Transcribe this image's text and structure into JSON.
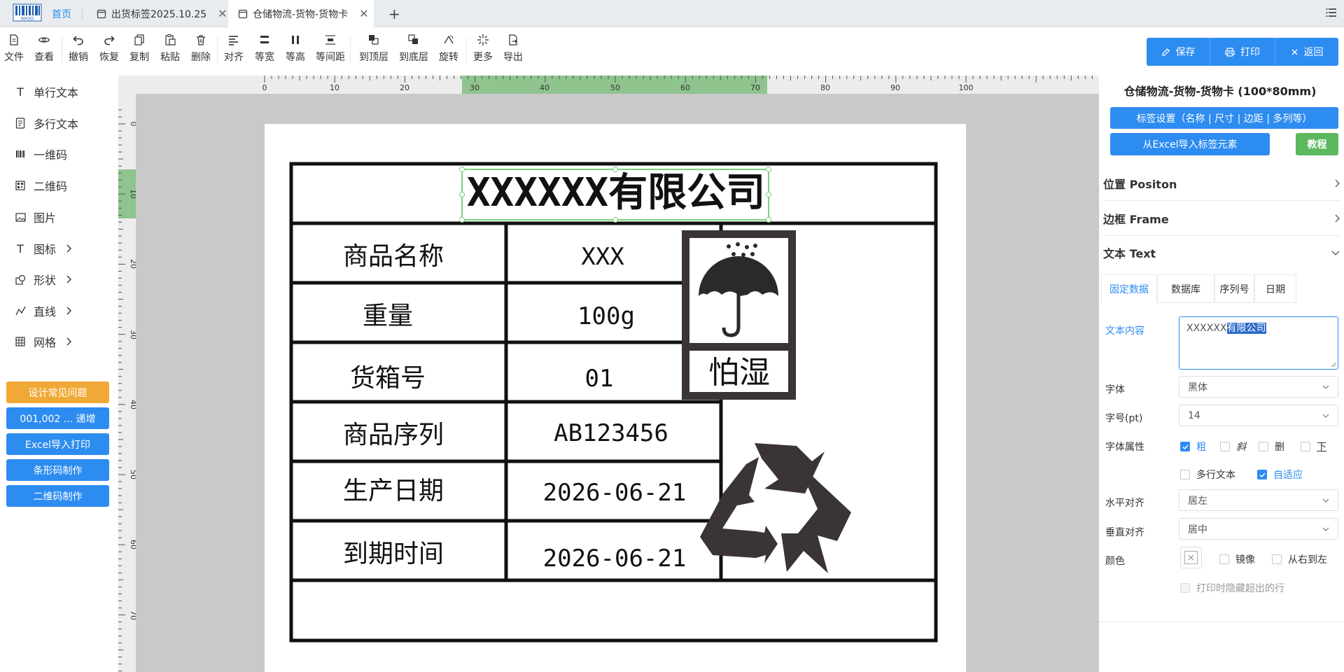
{
  "tabs": {
    "home": "首页",
    "tab1": "出货标签2025.10.25",
    "tab2": "仓储物流-货物-货物卡",
    "new_tab": "+",
    "logo_text": "MASO"
  },
  "toolbar": {
    "file": "文件",
    "view": "查看",
    "undo": "撤销",
    "redo": "恢复",
    "copy": "复制",
    "paste": "粘贴",
    "delete": "删除",
    "align": "对齐",
    "equal_width": "等宽",
    "equal_height": "等高",
    "equal_spacing": "等间距",
    "to_top": "到顶层",
    "to_bottom": "到底层",
    "rotate": "旋转",
    "more": "更多",
    "export": "导出",
    "save": "保存",
    "print": "打印",
    "back": "返回"
  },
  "left_panel": {
    "items": [
      "单行文本",
      "多行文本",
      "一维码",
      "二维码",
      "图片",
      "图标",
      "形状",
      "直线",
      "网格"
    ],
    "buttons": [
      "设计常见问题",
      "001,002 ... 递增",
      "Excel导入打印",
      "条形码制作",
      "二维码制作"
    ]
  },
  "rulers": {
    "top": [
      "0",
      "10",
      "20",
      "30",
      "40",
      "50",
      "60",
      "70",
      "80",
      "90",
      "100"
    ],
    "left": [
      "0",
      "10",
      "20",
      "30",
      "40",
      "50",
      "60",
      "70"
    ]
  },
  "label": {
    "company": "XXXXXX有限公司",
    "rows": [
      {
        "key": "商品名称",
        "value": "XXX"
      },
      {
        "key": "重量",
        "value": "100g"
      },
      {
        "key": "货箱号",
        "value": "01"
      },
      {
        "key": "商品序列",
        "value": "AB123456"
      },
      {
        "key": "生产日期",
        "value": "2026-06-21"
      },
      {
        "key": "到期时间",
        "value": "2026-06-21"
      }
    ],
    "moisture_text": "怕湿"
  },
  "right_panel": {
    "title": "仓储物流-货物-货物卡 (100*80mm)",
    "label_settings_btn": "标签设置（名称 | 尺寸 | 边距 | 多列等）",
    "excel_import_btn": "从Excel导入标签元素",
    "tutorial_btn": "教程",
    "sections": {
      "position": "位置 Positon",
      "frame": "边框 Frame",
      "text": "文本 Text"
    },
    "subtabs": [
      "固定数据",
      "数据库",
      "序列号",
      "日期"
    ],
    "fields": {
      "content_label": "文本内容",
      "content_value_plain": "XXXXXX",
      "content_value_selected": "有限公司",
      "font_label": "字体",
      "font_value": "黑体",
      "size_label": "字号(pt)",
      "size_value": "14",
      "attr_label": "字体属性",
      "bold": "粗",
      "italic": "斜",
      "strike": "删",
      "underline": "下",
      "multiline": "多行文本",
      "autofit": "自适应",
      "halign_label": "水平对齐",
      "halign_value": "居左",
      "valign_label": "垂直对齐",
      "valign_value": "居中",
      "color_label": "颜色",
      "mirror": "镜像",
      "rtl": "从右到左",
      "hide_overflow": "打印时隐藏超出的行"
    }
  },
  "colors": {
    "accent": "#2d8cf0",
    "orange": "#f0a936",
    "green": "#5cb85c",
    "selection": "#7ad27a"
  }
}
